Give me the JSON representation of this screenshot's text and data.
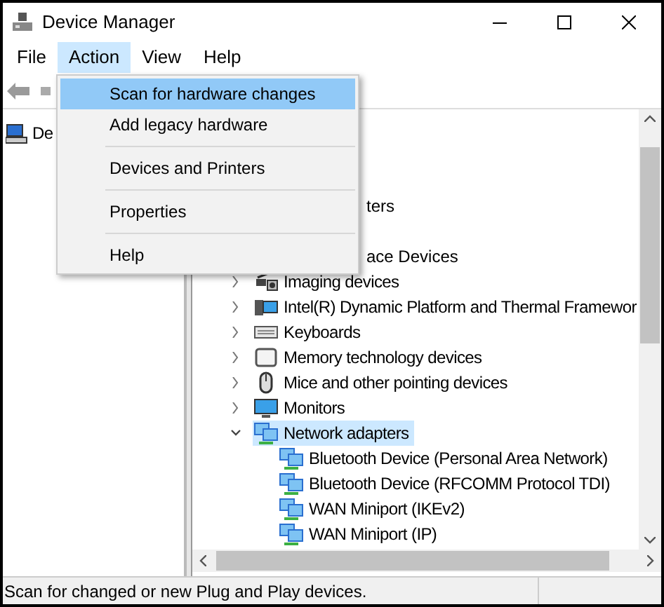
{
  "window": {
    "title": "Device Manager"
  },
  "menu_bar": [
    {
      "label": "File",
      "selected": false
    },
    {
      "label": "Action",
      "selected": true
    },
    {
      "label": "View",
      "selected": false
    },
    {
      "label": "Help",
      "selected": false
    }
  ],
  "action_menu": [
    {
      "kind": "item",
      "label": "Scan for hardware changes",
      "selected": true
    },
    {
      "kind": "item",
      "label": "Add legacy hardware",
      "selected": false
    },
    {
      "kind": "separator"
    },
    {
      "kind": "item",
      "label": "Devices and Printers",
      "selected": false
    },
    {
      "kind": "separator"
    },
    {
      "kind": "item",
      "label": "Properties",
      "selected": false
    },
    {
      "kind": "separator"
    },
    {
      "kind": "item",
      "label": "Help",
      "selected": false
    }
  ],
  "left_pane": {
    "node": "De"
  },
  "tree": [
    {
      "kind": "partial",
      "label": "ters"
    },
    {
      "kind": "partial",
      "label": "ace Devices"
    },
    {
      "kind": "category",
      "label": "Imaging devices",
      "expanded": false,
      "selected": false
    },
    {
      "kind": "category",
      "label": "Intel(R) Dynamic Platform and Thermal Framewor",
      "expanded": false,
      "selected": false
    },
    {
      "kind": "category",
      "label": "Keyboards",
      "expanded": false,
      "selected": false
    },
    {
      "kind": "category",
      "label": "Memory technology devices",
      "expanded": false,
      "selected": false
    },
    {
      "kind": "category",
      "label": "Mice and other pointing devices",
      "expanded": false,
      "selected": false
    },
    {
      "kind": "category",
      "label": "Monitors",
      "expanded": false,
      "selected": false
    },
    {
      "kind": "category",
      "label": "Network adapters",
      "expanded": true,
      "selected": true,
      "children": [
        {
          "label": "Bluetooth Device (Personal Area Network)",
          "selected": false
        },
        {
          "label": "Bluetooth Device (RFCOMM Protocol TDI)",
          "selected": false
        },
        {
          "label": "WAN Miniport (IKEv2)",
          "selected": false
        },
        {
          "label": "WAN Miniport (IP)",
          "selected": false
        }
      ]
    }
  ],
  "status_bar": {
    "text": "Scan for changed or new Plug and Play devices."
  }
}
